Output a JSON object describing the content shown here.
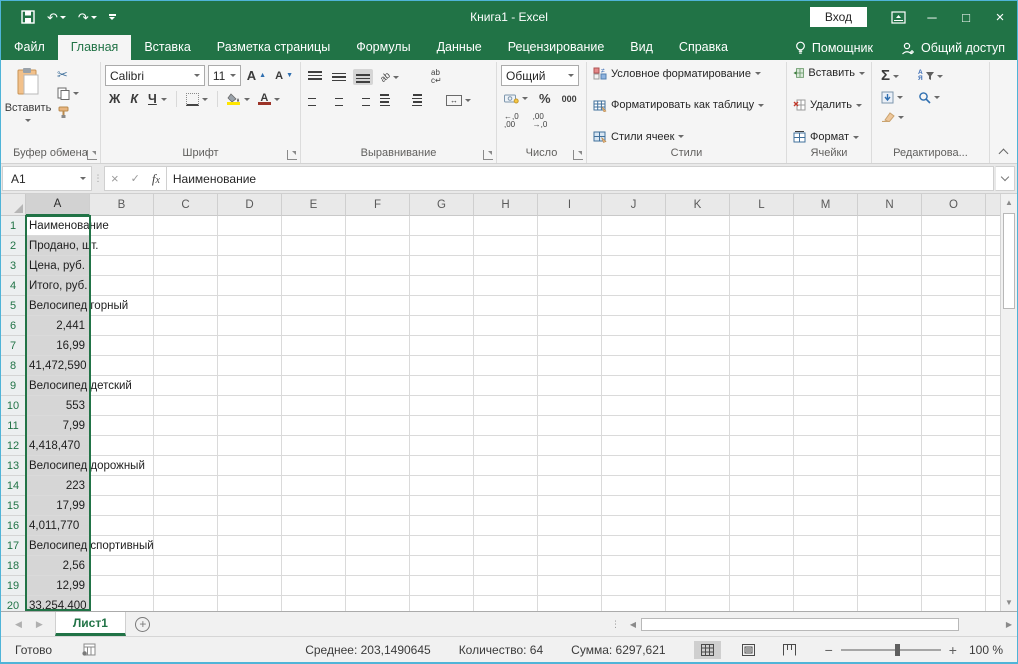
{
  "window": {
    "title": "Книга1 - Excel",
    "sign_in_label": "Вход"
  },
  "ribbon_tabs": [
    {
      "label": "Файл",
      "active": false
    },
    {
      "label": "Главная",
      "active": true
    },
    {
      "label": "Вставка",
      "active": false
    },
    {
      "label": "Разметка страницы",
      "active": false
    },
    {
      "label": "Формулы",
      "active": false
    },
    {
      "label": "Данные",
      "active": false
    },
    {
      "label": "Рецензирование",
      "active": false
    },
    {
      "label": "Вид",
      "active": false
    },
    {
      "label": "Справка",
      "active": false
    }
  ],
  "tab_extras": {
    "assistant": "Помощник",
    "share": "Общий доступ"
  },
  "ribbon": {
    "clipboard": {
      "group_label": "Буфер обмена",
      "paste_label": "Вставить"
    },
    "font": {
      "group_label": "Шрифт",
      "font_name": "Calibri",
      "font_size": "11",
      "bold": "Ж",
      "italic": "К",
      "underline": "Ч"
    },
    "alignment": {
      "group_label": "Выравнивание"
    },
    "number": {
      "group_label": "Число",
      "format": "Общий",
      "percent": "%",
      "thousands": "000"
    },
    "styles": {
      "group_label": "Стили",
      "items": [
        "Условное форматирование",
        "Форматировать как таблицу",
        "Стили ячеек"
      ]
    },
    "cells": {
      "group_label": "Ячейки",
      "items": [
        "Вставить",
        "Удалить",
        "Формат"
      ]
    },
    "editing": {
      "group_label": "Редактирова..."
    }
  },
  "formula_bar": {
    "name_box": "A1",
    "content": "Наименование"
  },
  "grid": {
    "columns": [
      "A",
      "B",
      "C",
      "D",
      "E",
      "F",
      "G",
      "H",
      "I",
      "J",
      "K",
      "L",
      "M",
      "N",
      "O"
    ],
    "selected_column": "A",
    "active_cell": "A1",
    "rows": [
      {
        "n": 1,
        "value": "Наименование",
        "align": "left",
        "active": true
      },
      {
        "n": 2,
        "value": "Продано, шт.",
        "align": "left"
      },
      {
        "n": 3,
        "value": "Цена, руб.",
        "align": "left"
      },
      {
        "n": 4,
        "value": "Итого, руб.",
        "align": "left"
      },
      {
        "n": 5,
        "value": "Велосипед горный",
        "align": "left"
      },
      {
        "n": 6,
        "value": "2,441",
        "align": "right"
      },
      {
        "n": 7,
        "value": "16,99",
        "align": "right"
      },
      {
        "n": 8,
        "value": "41,472,590",
        "align": "left"
      },
      {
        "n": 9,
        "value": "Велосипед детский",
        "align": "left"
      },
      {
        "n": 10,
        "value": "553",
        "align": "right"
      },
      {
        "n": 11,
        "value": "7,99",
        "align": "right"
      },
      {
        "n": 12,
        "value": "4,418,470",
        "align": "left"
      },
      {
        "n": 13,
        "value": "Велосипед дорожный",
        "align": "left"
      },
      {
        "n": 14,
        "value": "223",
        "align": "right"
      },
      {
        "n": 15,
        "value": "17,99",
        "align": "right"
      },
      {
        "n": 16,
        "value": "4,011,770",
        "align": "left"
      },
      {
        "n": 17,
        "value": "Велосипед спортивный",
        "align": "left"
      },
      {
        "n": 18,
        "value": "2,56",
        "align": "right"
      },
      {
        "n": 19,
        "value": "12,99",
        "align": "right"
      },
      {
        "n": 20,
        "value": "33,254,400",
        "align": "left"
      }
    ]
  },
  "sheet_bar": {
    "sheet_tab": "Лист1"
  },
  "status_bar": {
    "mode": "Готово",
    "average": "Среднее: 203,1490645",
    "count": "Количество: 64",
    "sum": "Сумма: 6297,621",
    "zoom_level": "100 %"
  },
  "colors": {
    "accent_green": "#217346",
    "selection_fill": "#d6d6d6",
    "highlight_yellow": "#ffe600",
    "font_color_red": "#9c3328",
    "window_border": "#4fb4d8"
  },
  "icons": {
    "quick_access": [
      "save-icon",
      "undo-icon",
      "redo-icon",
      "customize-qat-icon"
    ],
    "window": [
      "ribbon-display-options-icon",
      "minimize-icon",
      "maximize-icon",
      "close-icon"
    ],
    "tabrow": [
      "lightbulb-icon",
      "share-person-icon"
    ],
    "editing": [
      "autosum-icon",
      "sort-filter-icon",
      "fill-down-icon",
      "find-icon",
      "eraser-icon"
    ]
  }
}
